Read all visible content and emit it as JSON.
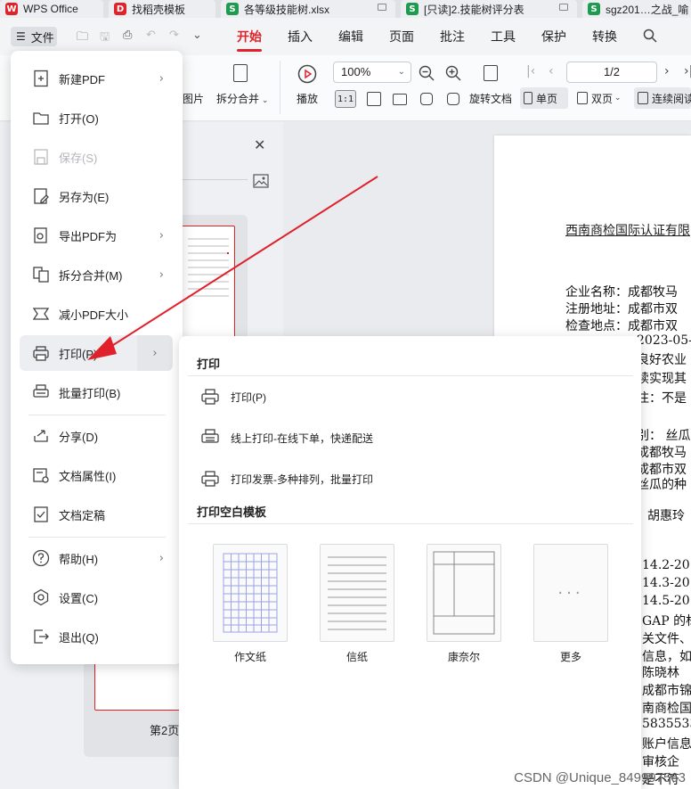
{
  "tabs": [
    {
      "label": "WPS Office",
      "icon": "wps-logo-icon",
      "color": "#e0232a"
    },
    {
      "label": "找稻壳模板",
      "icon": "docer-icon",
      "color": "#e0232a"
    },
    {
      "label": "各等级技能树.xlsx",
      "icon": "spreadsheet-icon",
      "color": "#1f9b4f"
    },
    {
      "label": "[只读]2.技能树评分表",
      "icon": "spreadsheet-icon",
      "color": "#1f9b4f"
    },
    {
      "label": "sgz201…之战_喻",
      "icon": "spreadsheet-icon",
      "color": "#1f9b4f"
    }
  ],
  "menubar": {
    "file_label": "文件",
    "tabs": [
      "开始",
      "插入",
      "编辑",
      "页面",
      "批注",
      "工具",
      "保护",
      "转换"
    ]
  },
  "toolbar": {
    "to_image": "图片",
    "split_merge": "拆分合并",
    "play": "播放",
    "zoom": "100%",
    "rotate_doc": "旋转文档",
    "single_page": "单页",
    "double_page": "双页",
    "continuous": "连续阅读",
    "page_indicator": "1/2"
  },
  "left_panel": {
    "thumb_label": "第2页"
  },
  "file_menu": {
    "items": [
      {
        "label": "新建PDF",
        "icon": "new-pdf-icon",
        "submenu": true
      },
      {
        "label": "打开(O)",
        "icon": "folder-icon"
      },
      {
        "label": "保存(S)",
        "icon": "save-icon",
        "disabled": true
      },
      {
        "label": "另存为(E)",
        "icon": "save-as-icon"
      },
      {
        "label": "导出PDF为",
        "icon": "export-pdf-icon",
        "submenu": true
      },
      {
        "label": "拆分合并(M)",
        "icon": "split-merge-icon",
        "submenu": true
      },
      {
        "label": "减小PDF大小",
        "icon": "compress-icon"
      },
      {
        "label": "打印(P)",
        "icon": "printer-icon",
        "submenu": true,
        "hover": true
      },
      {
        "label": "批量打印(B)",
        "icon": "batch-print-icon"
      },
      {
        "label": "分享(D)",
        "icon": "share-icon"
      },
      {
        "label": "文档属性(I)",
        "icon": "doc-properties-icon"
      },
      {
        "label": "文档定稿",
        "icon": "finalize-icon"
      },
      {
        "label": "帮助(H)",
        "icon": "help-icon",
        "submenu": true
      },
      {
        "label": "设置(C)",
        "icon": "settings-icon"
      },
      {
        "label": "退出(Q)",
        "icon": "exit-icon"
      }
    ]
  },
  "print_submenu": {
    "heading": "打印",
    "items": [
      {
        "label": "打印(P)",
        "icon": "printer-icon"
      },
      {
        "label": "线上打印-在线下单，快递配送",
        "icon": "online-print-icon"
      },
      {
        "label": "打印发票-多种排列，批量打印",
        "icon": "invoice-print-icon"
      }
    ],
    "templates_heading": "打印空白模板",
    "templates": [
      "作文纸",
      "信纸",
      "康奈尔",
      "更多"
    ]
  },
  "document": {
    "title": "西南商检国际认证有限",
    "lines": [
      "企业名称：成都牧马",
      "注册地址：成都市双",
      "检查地点：成都市双",
      "2023-05-",
      "良好农业",
      "续实现其",
      "注：不是",
      "别：  丝瓜",
      "成都牧马",
      "成都市双",
      "丝瓜的种",
      "胡惠玲",
      "14.2-20",
      "14.3-20",
      "14.5-20",
      "GAP 的标",
      "关文件、",
      "信息，如",
      "陈晓林",
      "成都市锦",
      "南商检国",
      "5835533",
      "账户信息",
      "审核企",
      "是不符"
    ]
  },
  "watermark": "CSDN @Unique_849997563"
}
